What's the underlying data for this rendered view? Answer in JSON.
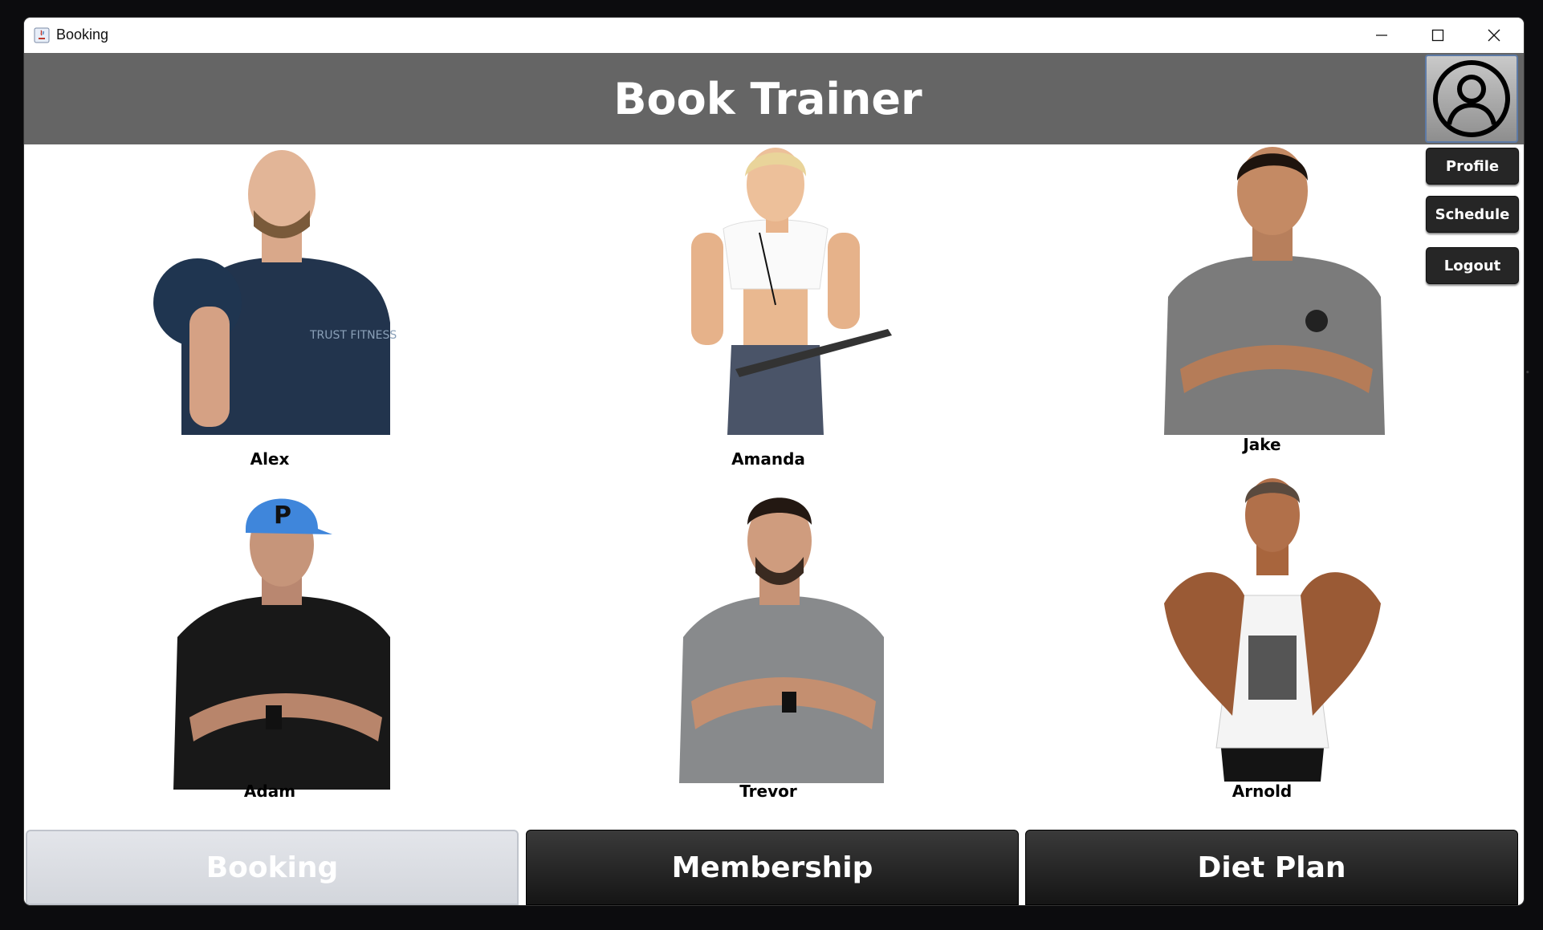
{
  "window": {
    "title": "Booking"
  },
  "header": {
    "title": "Book Trainer"
  },
  "side_menu": {
    "profile_label": "Profile",
    "schedule_label": "Schedule",
    "logout_label": "Logout"
  },
  "trainers": [
    {
      "name": "Alex"
    },
    {
      "name": "Amanda"
    },
    {
      "name": "Jake"
    },
    {
      "name": "Adam"
    },
    {
      "name": "Trevor"
    },
    {
      "name": "Arnold"
    }
  ],
  "nav": {
    "booking_label": "Booking",
    "membership_label": "Membership",
    "diet_plan_label": "Diet Plan",
    "active": "Booking"
  },
  "colors": {
    "header_bg": "#656565",
    "button_dark": "#262626",
    "tab_active": "#d9dce2"
  }
}
